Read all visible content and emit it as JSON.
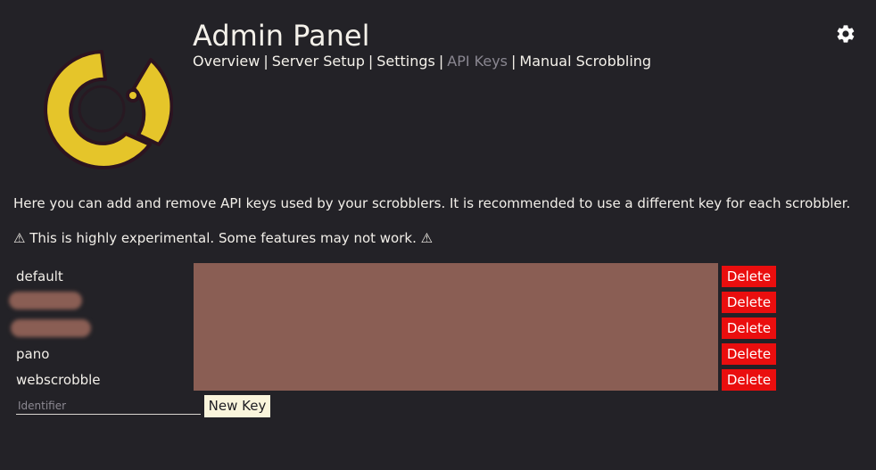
{
  "header": {
    "title": "Admin Panel",
    "nav": [
      {
        "label": "Overview",
        "active": false
      },
      {
        "label": "Server Setup",
        "active": false
      },
      {
        "label": "Settings",
        "active": false
      },
      {
        "label": "API Keys",
        "active": true
      },
      {
        "label": "Manual Scrobbling",
        "active": false
      }
    ],
    "separator": "|",
    "settings_icon": "gear-icon"
  },
  "logo": {
    "icon": "maloja-logo",
    "color": "#e5c52a"
  },
  "content": {
    "intro": "Here you can add and remove API keys used by your scrobblers. It is recommended to use a different key for each scrobbler.",
    "warning": "⚠ This is highly experimental. Some features may not work. ⚠"
  },
  "api_keys": {
    "rows": [
      {
        "identifier": "default",
        "redacted": false,
        "delete_label": "Delete"
      },
      {
        "identifier": "",
        "redacted": true,
        "delete_label": "Delete"
      },
      {
        "identifier": "",
        "redacted": true,
        "delete_label": "Delete"
      },
      {
        "identifier": "pano",
        "redacted": false,
        "delete_label": "Delete"
      },
      {
        "identifier": "webscrobble",
        "redacted": false,
        "delete_label": "Delete"
      }
    ],
    "key_values_redacted": true
  },
  "new_key": {
    "placeholder": "Identifier",
    "button_label": "New Key"
  },
  "colors": {
    "background": "#232227",
    "accent_yellow": "#e5c52a",
    "delete_red": "#ea0e0e",
    "redaction": "#8a5e54",
    "button_cream": "#faf5dc",
    "muted_text": "#8a8791"
  }
}
